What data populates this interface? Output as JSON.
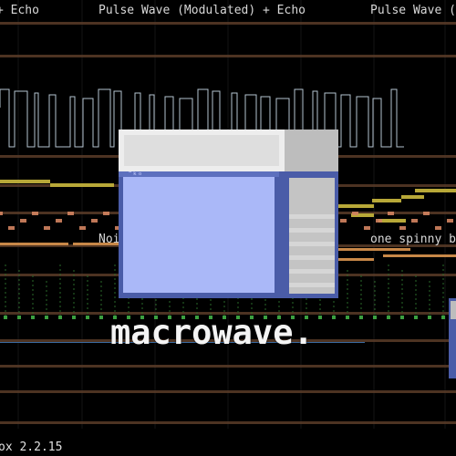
{
  "tracks": {
    "top_labels": [
      "+ Echo",
      "Pulse Wave (Modulated) + Echo",
      "Pulse Wave ("
    ],
    "mid_labels": [
      "Noi",
      "one spinny b"
    ]
  },
  "logo": {
    "title": "macrowave.",
    "window_glyph": "˜ᵏᵒ"
  },
  "footer": {
    "version": "ox 2.2.15"
  },
  "colors": {
    "background": "#000000",
    "track_divider": "#5a3c28",
    "note_yellow": "#b8a838",
    "note_salmon": "#d48460",
    "note_orange": "#c88848",
    "waveform": "#c8d8e8",
    "logo_frame": "#4a5ca8",
    "logo_pane": "#aab8f8",
    "title_text": "#f4f4f4"
  }
}
